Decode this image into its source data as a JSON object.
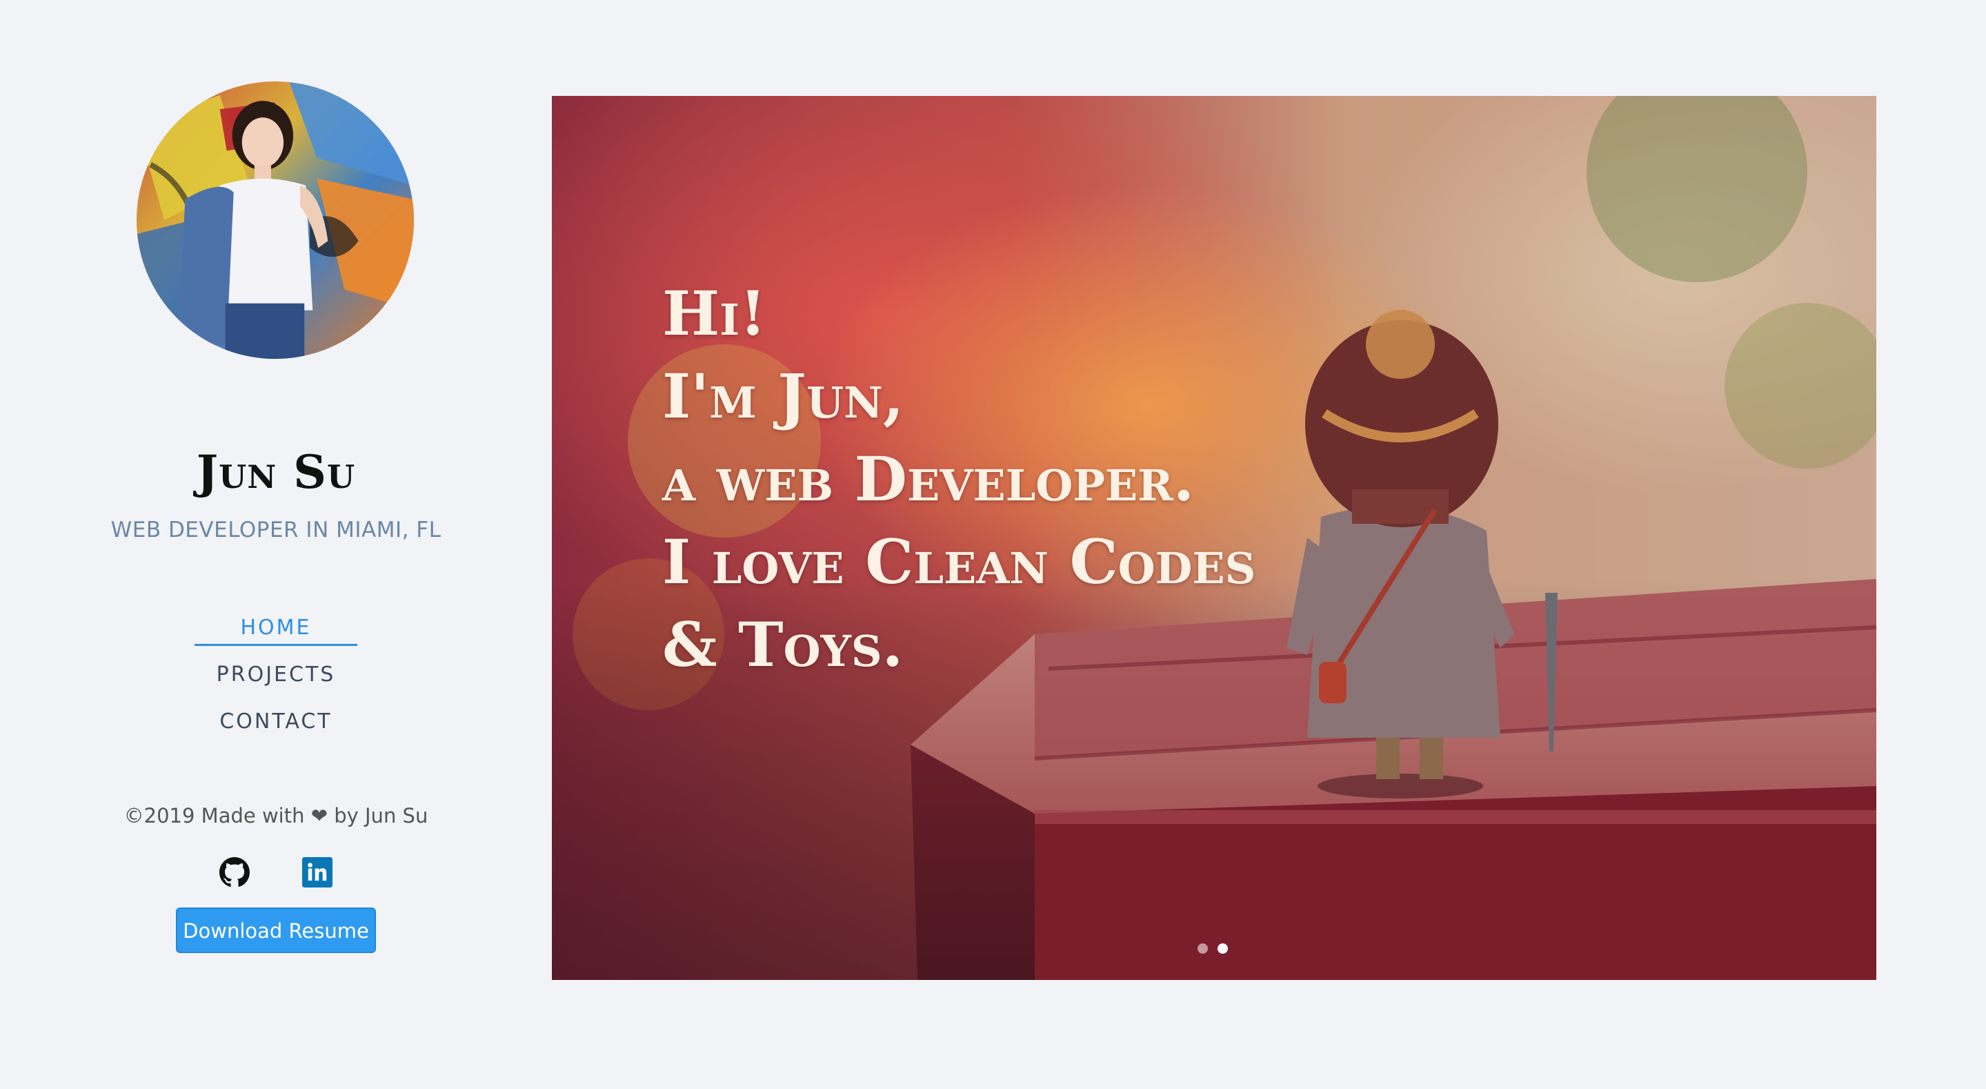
{
  "profile": {
    "name": "Jun Su",
    "subtitle": "WEB DEVELOPER IN MIAMI, FL",
    "avatar_alt": "profile photo"
  },
  "nav": {
    "items": [
      {
        "label": "HOME",
        "active": true
      },
      {
        "label": "PROJECTS",
        "active": false
      },
      {
        "label": "CONTACT",
        "active": false
      }
    ]
  },
  "footer": {
    "copyright_prefix": "©2019 Made with ",
    "heart": "❤",
    "copyright_suffix": " by Jun Su",
    "social": [
      {
        "icon": "github-icon",
        "label": "GitHub"
      },
      {
        "icon": "linkedin-icon",
        "label": "LinkedIn"
      }
    ],
    "resume_label": "Download Resume"
  },
  "hero": {
    "lines": [
      "Hi!",
      "I'm Jun,",
      "a web Developer.",
      "I love Clean Codes",
      "& Toys."
    ],
    "slides": [
      {
        "active": false
      },
      {
        "active": true
      }
    ]
  },
  "colors": {
    "accent": "#2f8fe0",
    "button": "#2f9bf0",
    "background": "#f2f3f7",
    "subtitle": "#6b87a6"
  }
}
